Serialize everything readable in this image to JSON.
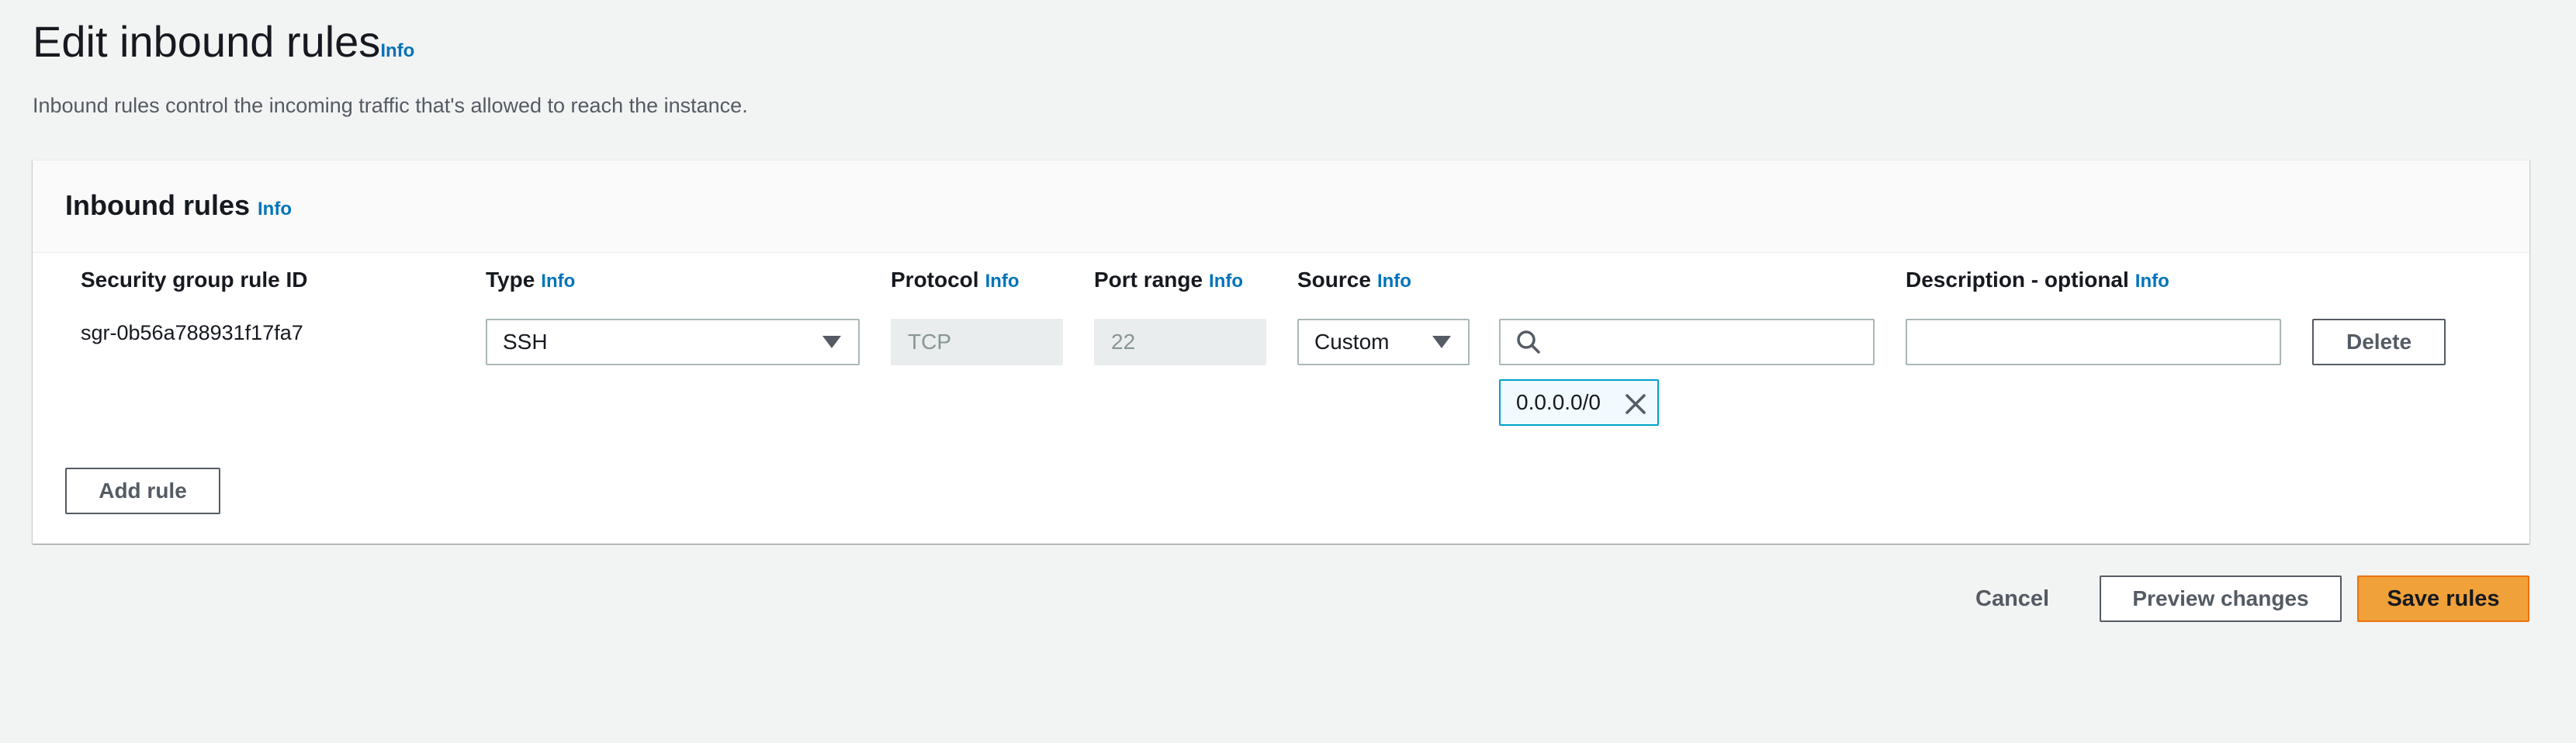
{
  "page": {
    "title": "Edit inbound rules",
    "title_info": "Info",
    "description": "Inbound rules control the incoming traffic that's allowed to reach the instance."
  },
  "panel": {
    "title": "Inbound rules",
    "title_info": "Info",
    "columns": {
      "rule_id": "Security group rule ID",
      "type": "Type",
      "type_info": "Info",
      "protocol": "Protocol",
      "protocol_info": "Info",
      "port_range": "Port range",
      "port_range_info": "Info",
      "source": "Source",
      "source_info": "Info",
      "description": "Description - optional",
      "description_info": "Info"
    },
    "rules": [
      {
        "rule_id": "sgr-0b56a788931f17fa7",
        "type": "SSH",
        "protocol": "TCP",
        "port_range": "22",
        "source_type": "Custom",
        "source_search_value": "",
        "source_tokens": [
          "0.0.0.0/0"
        ],
        "description_value": "",
        "delete_label": "Delete"
      }
    ],
    "add_rule_label": "Add rule"
  },
  "footer": {
    "cancel_label": "Cancel",
    "preview_label": "Preview changes",
    "save_label": "Save rules"
  },
  "colors": {
    "info_link": "#0073bb",
    "primary_button": "#f0a13a",
    "token_border": "#00a1c9"
  },
  "icons": {
    "source_search": "search-icon",
    "token_remove": "close-icon",
    "dropdown": "caret-down-icon"
  }
}
